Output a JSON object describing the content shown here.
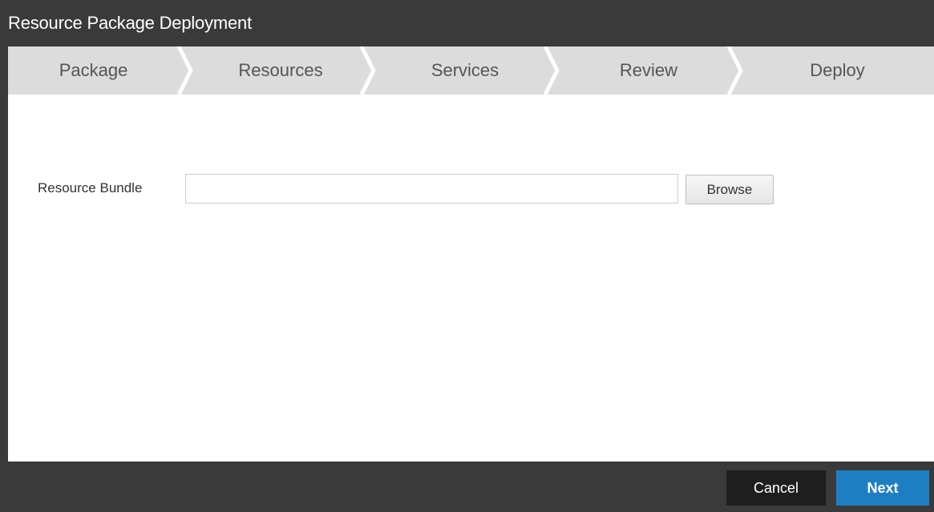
{
  "dialog": {
    "title": "Resource Package Deployment"
  },
  "wizard": {
    "steps": [
      {
        "label": "Package"
      },
      {
        "label": "Resources"
      },
      {
        "label": "Services"
      },
      {
        "label": "Review"
      },
      {
        "label": "Deploy"
      }
    ],
    "active_step": "Package"
  },
  "form": {
    "resource_bundle_label": "Resource Bundle",
    "resource_bundle_value": "",
    "browse_label": "Browse"
  },
  "footer": {
    "cancel_label": "Cancel",
    "next_label": "Next"
  },
  "colors": {
    "chrome_background": "#3a3a3a",
    "step_background": "#dcdcdc",
    "step_separator": "#ffffff",
    "primary_button": "#1d7fc2",
    "secondary_button": "#1e1e1e"
  }
}
